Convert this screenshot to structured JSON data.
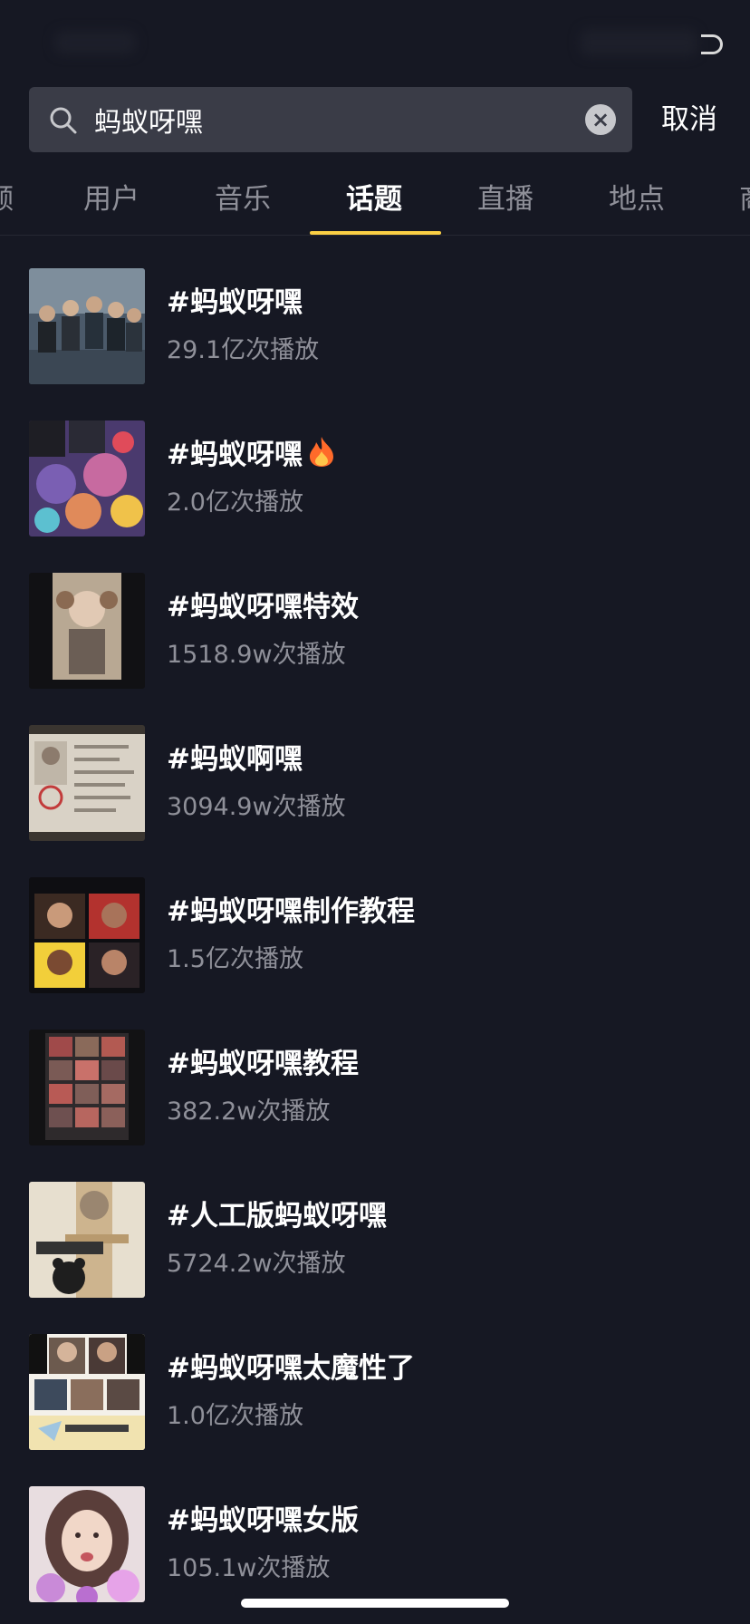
{
  "search": {
    "query": "蚂蚁呀嘿",
    "cancel_label": "取消"
  },
  "tabs": [
    {
      "label": "频",
      "active": false
    },
    {
      "label": "用户",
      "active": false
    },
    {
      "label": "音乐",
      "active": false
    },
    {
      "label": "话题",
      "active": true
    },
    {
      "label": "直播",
      "active": false
    },
    {
      "label": "地点",
      "active": false
    },
    {
      "label": "商",
      "active": false
    }
  ],
  "results": [
    {
      "title": "#蚂蚁呀嘿",
      "plays": "29.1亿次播放",
      "hot": false
    },
    {
      "title": "#蚂蚁呀嘿",
      "plays": "2.0亿次播放",
      "hot": true
    },
    {
      "title": "#蚂蚁呀嘿特效",
      "plays": "1518.9w次播放",
      "hot": false
    },
    {
      "title": "#蚂蚁啊嘿",
      "plays": "3094.9w次播放",
      "hot": false
    },
    {
      "title": "#蚂蚁呀嘿制作教程",
      "plays": "1.5亿次播放",
      "hot": false
    },
    {
      "title": "#蚂蚁呀嘿教程",
      "plays": "382.2w次播放",
      "hot": false
    },
    {
      "title": "#人工版蚂蚁呀嘿",
      "plays": "5724.2w次播放",
      "hot": false
    },
    {
      "title": "#蚂蚁呀嘿太魔性了",
      "plays": "1.0亿次播放",
      "hot": false
    },
    {
      "title": "#蚂蚁呀嘿女版",
      "plays": "105.1w次播放",
      "hot": false
    }
  ],
  "icons": {
    "search": "search-icon",
    "clear": "close-circle-icon",
    "hot": "fire-icon",
    "battery": "battery-icon"
  },
  "colors": {
    "background": "#161823",
    "search_box": "#3a3c47",
    "accent_underline": "#facf44",
    "secondary_text": "#8f9099"
  }
}
